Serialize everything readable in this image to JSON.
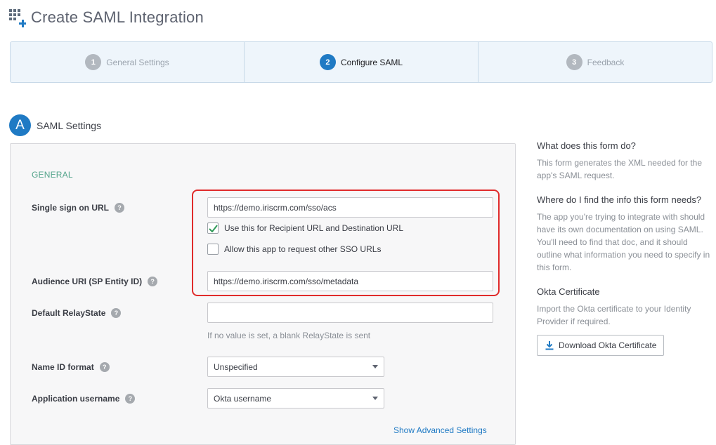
{
  "header": {
    "title": "Create SAML Integration",
    "icon": "app-grid-add-icon"
  },
  "wizard": {
    "steps": [
      {
        "number": "1",
        "label": "General Settings",
        "state": "inactive"
      },
      {
        "number": "2",
        "label": "Configure SAML",
        "state": "active"
      },
      {
        "number": "3",
        "label": "Feedback",
        "state": "inactive"
      }
    ]
  },
  "section": {
    "badge": "A",
    "title": "SAML Settings"
  },
  "form": {
    "group_label": "GENERAL",
    "sso_url": {
      "label": "Single sign on URL",
      "value": "https://demo.iriscrm.com/sso/acs"
    },
    "use_recipient": {
      "label": "Use this for Recipient URL and Destination URL",
      "checked": true
    },
    "allow_other_sso": {
      "label": "Allow this app to request other SSO URLs",
      "checked": false
    },
    "audience_uri": {
      "label": "Audience URI (SP Entity ID)",
      "value": "https://demo.iriscrm.com/sso/metadata"
    },
    "relay_state": {
      "label": "Default RelayState",
      "value": "",
      "hint": "If no value is set, a blank RelayState is sent"
    },
    "name_id_format": {
      "label": "Name ID format",
      "value": "Unspecified"
    },
    "app_username": {
      "label": "Application username",
      "value": "Okta username"
    },
    "advanced_link": "Show Advanced Settings",
    "help_glyph": "?"
  },
  "sidebar": {
    "q1": "What does this form do?",
    "a1": "This form generates the XML needed for the app's SAML request.",
    "q2": "Where do I find the info this form needs?",
    "a2": "The app you're trying to integrate with should have its own documentation on using SAML. You'll need to find that doc, and it should outline what information you need to specify in this form.",
    "q3": "Okta Certificate",
    "a3": "Import the Okta certificate to your Identity Provider if required.",
    "download_label": "Download Okta Certificate"
  },
  "colors": {
    "accent": "#1f7ac4",
    "highlight": "#e02b2b",
    "group_label": "#55a58c"
  }
}
